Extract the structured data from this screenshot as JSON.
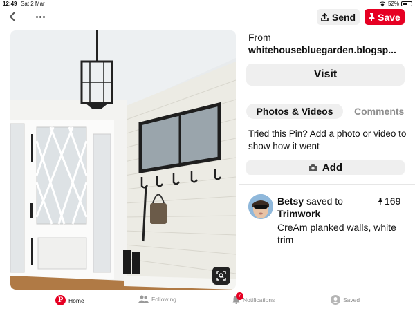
{
  "status_bar": {
    "time": "12:49",
    "date": "Sat 2 Mar",
    "battery": "52%",
    "battery_level": 0.52
  },
  "top_bar": {
    "send_label": "Send",
    "save_label": "Save",
    "save_color": "#e60023"
  },
  "pin": {
    "image_description_icon": "visual-search-icon"
  },
  "details": {
    "from_label": "From",
    "source": "whitehousebluegarden.blogsp...",
    "visit_label": "Visit",
    "tabs": [
      {
        "label": "Photos & Videos",
        "active": true
      },
      {
        "label": "Comments",
        "active": false
      }
    ],
    "tried_prompt": "Tried this Pin? Add a photo or video to show how it went",
    "add_label": "Add",
    "saver_name": "Betsy",
    "saved_to_text": "saved to",
    "saves_count": "169",
    "board_name": "Trimwork",
    "description": "CreAm planked walls, white trim"
  },
  "tab_bar": {
    "home": "Home",
    "following": "Following",
    "notifications": "Notifications",
    "notifications_badge": "7",
    "saved": "Saved"
  }
}
